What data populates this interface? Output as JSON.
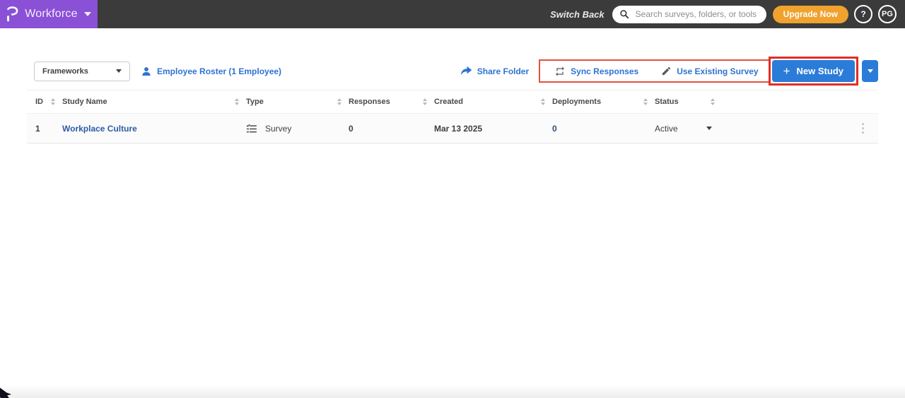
{
  "topbar": {
    "brand": {
      "product": "Workforce"
    },
    "switch_back": "Switch Back",
    "search": {
      "placeholder": "Search surveys, folders, or tools"
    },
    "upgrade_label": "Upgrade Now",
    "help_label": "?",
    "avatar_initials": "PG"
  },
  "toolbar": {
    "folder_dropdown": {
      "value": "Frameworks"
    },
    "roster_link": {
      "label": "Employee Roster (1 Employee)"
    },
    "share_folder": {
      "label": "Share Folder"
    },
    "sync_responses": {
      "label": "Sync Responses"
    },
    "use_existing": {
      "label": "Use Existing Survey"
    },
    "new_study": {
      "label": "New Study",
      "plus": "+"
    }
  },
  "table": {
    "columns": [
      "ID",
      "Study Name",
      "Type",
      "Responses",
      "Created",
      "Deployments",
      "Status"
    ],
    "rows": [
      {
        "id": "1",
        "name": "Workplace Culture",
        "type": "Survey",
        "responses": "0",
        "created": "Mar 13 2025",
        "deployments": "0",
        "status": "Active"
      }
    ]
  },
  "icons": {
    "brand_logo": "p-glyph",
    "search": "magnifier",
    "roster": "person",
    "share_folder": "forward-arrow",
    "sync": "repeat-arrows",
    "use_existing": "pencil",
    "survey_type": "checklist",
    "sort": "up-down-triangles",
    "row_menu": "kebab-dots",
    "dropdown": "caret-down"
  },
  "colors": {
    "brand_purple": "#8a50d6",
    "topbar_gray": "#3b3b3b",
    "accent_orange": "#efa22e",
    "link_blue": "#2e73d2",
    "button_blue": "#2b7cd9",
    "study_link_navy": "#2b5ca6",
    "annotation_red_thick": "#df2f23",
    "annotation_red_thin": "#e0523c"
  }
}
